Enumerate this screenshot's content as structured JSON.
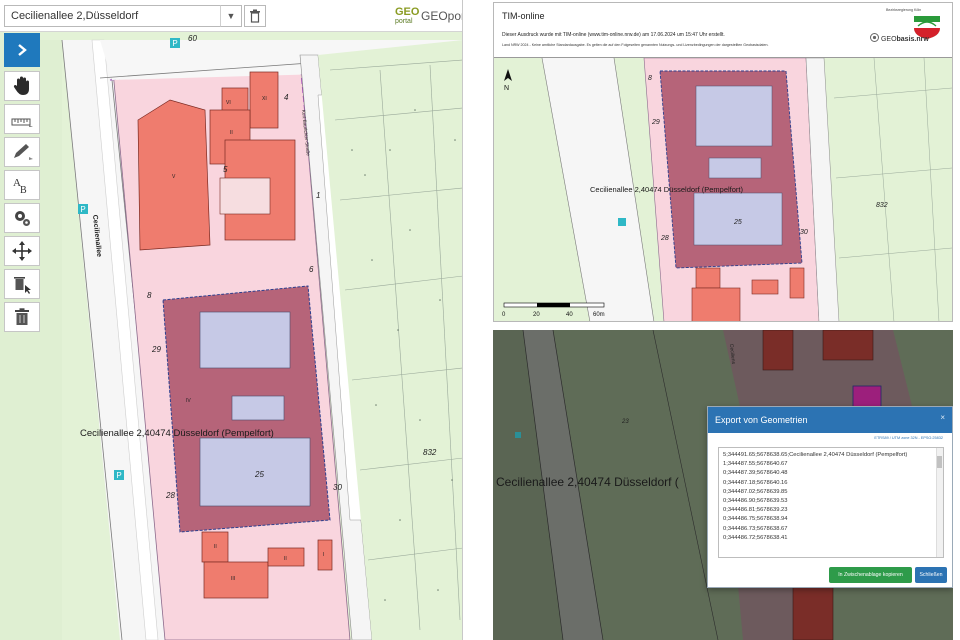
{
  "search": {
    "value": "Cecilienallee 2,Düsseldorf"
  },
  "logo": {
    "mark": "GEO",
    "sub": "portal",
    "text": "GEOportal.NRW"
  },
  "toolbar": {
    "buttons": [
      {
        "name": "expand-button",
        "icon": "chevron-right-icon"
      },
      {
        "name": "pan-button",
        "icon": "hand-icon"
      },
      {
        "name": "measure-button",
        "icon": "ruler-icon"
      },
      {
        "name": "draw-button",
        "icon": "pencil-icon"
      },
      {
        "name": "text-button",
        "icon": "text-label-icon"
      },
      {
        "name": "settings-button",
        "icon": "gears-icon"
      },
      {
        "name": "move-button",
        "icon": "move-arrows-icon"
      },
      {
        "name": "delete-feature-button",
        "icon": "trash-cursor-icon"
      },
      {
        "name": "delete-all-button",
        "icon": "trash-icon"
      }
    ]
  },
  "left_map": {
    "address": "Cecilienallee 2,40474 Düsseldorf (Pempelfort)",
    "street_cecilienallee": "Cecilienallee",
    "street_kurt": "Kurt-Baurichter-Straße",
    "labels": [
      "60",
      "4",
      "5",
      "1",
      "6",
      "8",
      "29",
      "25",
      "28",
      "30",
      "832"
    ],
    "roman": [
      "VI",
      "XI",
      "II",
      "V",
      "IV",
      "II",
      "II",
      "III",
      "I"
    ],
    "parking": "P"
  },
  "print_header": {
    "title": "TIM-online",
    "line1": "Dieser Ausdruck wurde mit TIM-online (www.tim-online.nrw.de) am 17.06.2024 um 15:47 Uhr erstellt.",
    "line2": "Land NRW 2024 - Keine amtliche Standardausgabe. Es gelten die auf den Folgeseiten genannten Nutzungs- und Lizenzbedingungen der dargestellten Geobasisdaten.",
    "org": "Bezirksregierung Köln",
    "geobasis_a": "GEO",
    "geobasis_b": "basis.nrw"
  },
  "print_map": {
    "address": "Cecilienallee 2,40474 Düsseldorf (Pempelfort)",
    "north": "N",
    "labels": [
      "8",
      "29",
      "25",
      "28",
      "30",
      "832"
    ],
    "scale_ticks": [
      "0",
      "20",
      "40",
      "60m"
    ]
  },
  "bottom_map": {
    "address": "Cecilienallee 2,40474 Düsseldorf (",
    "labels": [
      "23"
    ]
  },
  "dialog": {
    "title": "Export von Geometrien",
    "close": "×",
    "crs": "ETRS89 / UTM zone 32N - EPSG:25832",
    "rows": [
      "5;344491.65;5678638.65;Cecilienallee 2,40474 Düsseldorf (Pempelfort)",
      "1;344487.55;5678640.67",
      "0;344487.39;5678640.48",
      "0;344487.18;5678640.16",
      "0;344487.02;5678639.85",
      "0;344486.90;5678639.53",
      "0;344486.81;5678639.23",
      "0;344486.75;5678638.94",
      "0;344486.73;5678638.67",
      "0;344486.72;5678638.41"
    ],
    "copy_label": "In Zwischenablage kopieren",
    "close_label": "Schließen"
  }
}
